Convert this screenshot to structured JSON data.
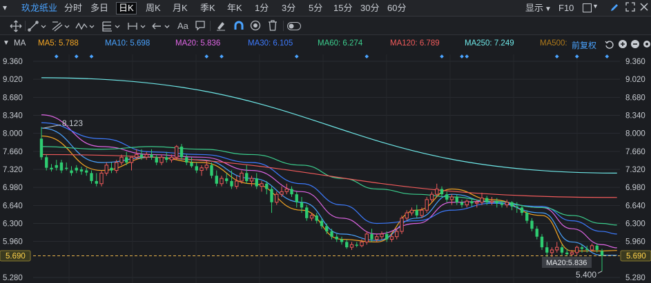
{
  "header": {
    "stock_name": "玖龙纸业",
    "tabs": [
      "分时",
      "多日",
      "日K",
      "周K",
      "月K",
      "季K",
      "年K",
      "1分",
      "3分",
      "5分",
      "15分",
      "30分",
      "60分"
    ],
    "active_tab": "日K",
    "display_label": "显示",
    "f10_label": "F10"
  },
  "toolbar": {
    "icons": [
      "move-cross-icon",
      "line-tool-icon",
      "channel-tool-icon",
      "wave-tool-icon",
      "fib-tool-icon",
      "measure-tool-icon",
      "arrow-tool-icon",
      "text-tool-icon",
      "comment-tool-icon",
      "eraser-icon",
      "magnet-icon",
      "eye-icon",
      "trash-icon",
      "toggle-icon"
    ],
    "text_label": "Aa"
  },
  "indicator": {
    "name": "MA",
    "items": [
      {
        "label": "MA5: 5.788",
        "color": "#f5a623"
      },
      {
        "label": "MA10: 5.698",
        "color": "#4aa3ff"
      },
      {
        "label": "MA20: 5.836",
        "color": "#e066e6"
      },
      {
        "label": "MA30: 6.105",
        "color": "#3d7bff"
      },
      {
        "label": "MA60: 6.274",
        "color": "#3ccf8e"
      },
      {
        "label": "MA120: 6.789",
        "color": "#f25b5b"
      },
      {
        "label": "MA250: 7.249",
        "color": "#6fe8e8"
      },
      {
        "label": "MA500:",
        "color": "#b07a1a"
      }
    ],
    "adjust_label": "前复权"
  },
  "chart_data": {
    "type": "candlestick",
    "y_ticks": [
      "9.360",
      "9.020",
      "8.680",
      "8.340",
      "8.000",
      "7.660",
      "7.320",
      "6.980",
      "6.640",
      "6.300",
      "5.960",
      "5.280"
    ],
    "current_price": "5.690",
    "high_label": "8.123",
    "low_label": "5.400",
    "tooltip": "MA20:5.836",
    "ylim": [
      5.2,
      9.4
    ],
    "colors": {
      "up": "#f25b5b",
      "down": "#2ecc71"
    },
    "candles": [
      [
        7.9,
        8.12,
        7.55,
        7.5
      ],
      [
        7.55,
        7.6,
        7.35,
        7.3
      ],
      [
        7.35,
        7.42,
        7.32,
        7.28
      ],
      [
        7.4,
        7.5,
        7.35,
        7.3
      ],
      [
        7.45,
        7.5,
        7.3,
        7.25
      ],
      [
        7.35,
        7.45,
        7.33,
        7.3
      ],
      [
        7.3,
        7.38,
        7.25,
        7.2
      ],
      [
        7.35,
        7.4,
        7.3,
        7.25
      ],
      [
        7.32,
        7.37,
        7.28,
        7.22
      ],
      [
        7.3,
        7.35,
        7.26,
        7.2
      ],
      [
        7.25,
        7.3,
        7.1,
        7.05
      ],
      [
        7.1,
        7.25,
        7.05,
        7.0
      ],
      [
        7.05,
        7.3,
        7.25,
        7.0
      ],
      [
        7.25,
        7.45,
        7.4,
        7.2
      ],
      [
        7.35,
        7.45,
        7.3,
        7.25
      ],
      [
        7.3,
        7.5,
        7.45,
        7.25
      ],
      [
        7.45,
        7.6,
        7.55,
        7.4
      ],
      [
        7.55,
        7.65,
        7.45,
        7.4
      ],
      [
        7.45,
        7.5,
        7.55,
        7.3
      ],
      [
        7.55,
        7.7,
        7.6,
        7.5
      ],
      [
        7.6,
        7.7,
        7.55,
        7.5
      ],
      [
        7.55,
        7.65,
        7.6,
        7.5
      ],
      [
        7.6,
        7.7,
        7.55,
        7.5
      ],
      [
        7.55,
        7.6,
        7.45,
        7.4
      ],
      [
        7.45,
        7.6,
        7.55,
        7.4
      ],
      [
        7.55,
        7.65,
        7.5,
        7.45
      ],
      [
        7.5,
        7.6,
        7.55,
        7.45
      ],
      [
        7.55,
        7.78,
        7.75,
        7.5
      ],
      [
        7.75,
        7.8,
        7.55,
        7.5
      ],
      [
        7.55,
        7.6,
        7.45,
        7.4
      ],
      [
        7.45,
        7.55,
        7.38,
        7.35
      ],
      [
        7.38,
        7.45,
        7.3,
        7.25
      ],
      [
        7.3,
        7.4,
        7.35,
        7.2
      ],
      [
        7.35,
        7.5,
        7.4,
        7.3
      ],
      [
        7.4,
        7.45,
        7.2,
        7.15
      ],
      [
        7.2,
        7.3,
        7.05,
        7.0
      ],
      [
        7.05,
        7.2,
        7.15,
        7.0
      ],
      [
        7.15,
        7.25,
        7.1,
        7.05
      ],
      [
        7.1,
        7.3,
        7.0,
        6.95
      ],
      [
        7.0,
        7.2,
        7.1,
        6.95
      ],
      [
        7.1,
        7.3,
        7.25,
        7.05
      ],
      [
        7.25,
        7.4,
        7.1,
        7.05
      ],
      [
        7.1,
        7.2,
        7.15,
        7.0
      ],
      [
        7.15,
        7.25,
        7.0,
        6.95
      ],
      [
        7.0,
        7.1,
        7.05,
        6.9
      ],
      [
        7.05,
        7.1,
        6.95,
        6.85
      ],
      [
        6.95,
        7.0,
        6.7,
        6.5
      ],
      [
        6.7,
        6.9,
        6.85,
        6.65
      ],
      [
        6.85,
        7.0,
        6.9,
        6.8
      ],
      [
        6.9,
        7.05,
        6.95,
        6.85
      ],
      [
        6.95,
        7.0,
        6.85,
        6.8
      ],
      [
        6.85,
        6.9,
        6.7,
        6.6
      ],
      [
        6.7,
        6.8,
        6.6,
        6.5
      ],
      [
        6.6,
        6.65,
        6.4,
        6.35
      ],
      [
        6.4,
        6.5,
        6.45,
        6.35
      ],
      [
        6.45,
        6.5,
        6.35,
        6.3
      ],
      [
        6.35,
        6.4,
        6.25,
        6.2
      ],
      [
        6.25,
        6.3,
        6.15,
        6.1
      ],
      [
        6.15,
        6.2,
        6.05,
        6.0
      ],
      [
        6.05,
        6.1,
        6.0,
        5.95
      ],
      [
        6.0,
        6.05,
        5.95,
        5.9
      ],
      [
        5.95,
        6.0,
        5.85,
        5.82
      ],
      [
        5.85,
        5.95,
        5.9,
        5.8
      ],
      [
        5.9,
        5.95,
        5.88,
        5.85
      ],
      [
        5.88,
        6.0,
        5.95,
        5.85
      ],
      [
        5.95,
        6.15,
        6.1,
        5.9
      ],
      [
        6.1,
        6.2,
        6.0,
        5.95
      ],
      [
        6.0,
        6.1,
        6.05,
        5.95
      ],
      [
        6.05,
        6.15,
        6.1,
        6.0
      ],
      [
        6.1,
        6.15,
        6.0,
        5.95
      ],
      [
        6.0,
        6.1,
        6.05,
        5.95
      ],
      [
        6.05,
        6.2,
        6.15,
        6.0
      ],
      [
        6.15,
        6.45,
        6.4,
        6.1
      ],
      [
        6.4,
        6.55,
        6.5,
        6.35
      ],
      [
        6.5,
        6.6,
        6.55,
        6.45
      ],
      [
        6.55,
        6.65,
        6.45,
        6.4
      ],
      [
        6.45,
        6.6,
        6.55,
        6.4
      ],
      [
        6.55,
        6.8,
        6.75,
        6.5
      ],
      [
        6.75,
        6.9,
        6.85,
        6.7
      ],
      [
        6.85,
        7.05,
        6.95,
        6.8
      ],
      [
        6.95,
        7.0,
        6.85,
        6.8
      ],
      [
        6.85,
        6.9,
        6.75,
        6.7
      ],
      [
        6.75,
        6.85,
        6.8,
        6.65
      ],
      [
        6.8,
        6.85,
        6.7,
        6.65
      ],
      [
        6.7,
        6.75,
        6.65,
        6.6
      ],
      [
        6.65,
        6.75,
        6.72,
        6.6
      ],
      [
        6.72,
        6.78,
        6.68,
        6.62
      ],
      [
        6.68,
        6.75,
        6.7,
        6.6
      ],
      [
        6.7,
        6.88,
        6.78,
        6.65
      ],
      [
        6.78,
        6.82,
        6.7,
        6.65
      ],
      [
        6.7,
        6.8,
        6.72,
        6.65
      ],
      [
        6.72,
        6.78,
        6.68,
        6.6
      ],
      [
        6.68,
        6.72,
        6.65,
        6.6
      ],
      [
        6.65,
        6.75,
        6.7,
        6.6
      ],
      [
        6.7,
        6.72,
        6.62,
        6.55
      ],
      [
        6.62,
        6.7,
        6.6,
        6.5
      ],
      [
        6.6,
        6.65,
        6.5,
        6.45
      ],
      [
        6.5,
        6.55,
        6.35,
        6.3
      ],
      [
        6.35,
        6.4,
        6.2,
        6.15
      ],
      [
        6.2,
        6.25,
        6.05,
        6.0
      ],
      [
        6.05,
        6.1,
        5.85,
        5.8
      ],
      [
        5.85,
        5.95,
        5.75,
        5.65
      ],
      [
        5.75,
        5.85,
        5.8,
        5.6
      ],
      [
        5.8,
        5.95,
        5.85,
        5.75
      ],
      [
        5.85,
        5.9,
        5.75,
        5.7
      ],
      [
        5.75,
        5.82,
        5.72,
        5.68
      ],
      [
        5.72,
        5.8,
        5.75,
        5.68
      ],
      [
        5.75,
        5.88,
        5.85,
        5.7
      ],
      [
        5.85,
        5.9,
        5.82,
        5.75
      ],
      [
        5.82,
        5.88,
        5.8,
        5.75
      ],
      [
        5.8,
        5.92,
        5.88,
        5.78
      ],
      [
        5.88,
        5.92,
        5.8,
        5.75
      ],
      [
        5.78,
        5.82,
        5.69,
        5.4
      ]
    ],
    "ma_lines": [
      {
        "name": "MA5",
        "color": "#f5a623",
        "x": [
          0,
          12,
          22,
          32,
          42,
          52,
          60,
          67,
          75,
          82,
          90,
          100,
          106,
          112,
          115
        ],
        "y": [
          7.95,
          7.3,
          7.55,
          7.45,
          7.05,
          6.55,
          6.0,
          5.95,
          6.55,
          6.95,
          6.75,
          6.45,
          5.78,
          5.78,
          5.79
        ]
      },
      {
        "name": "MA10",
        "color": "#4aa3ff",
        "x": [
          0,
          12,
          22,
          32,
          42,
          52,
          60,
          67,
          75,
          82,
          90,
          100,
          106,
          112,
          115
        ],
        "y": [
          8.1,
          7.45,
          7.55,
          7.5,
          7.15,
          6.7,
          6.1,
          5.98,
          6.4,
          6.85,
          6.7,
          6.5,
          5.95,
          5.7,
          5.7
        ]
      },
      {
        "name": "MA20",
        "color": "#e066e6",
        "x": [
          0,
          12,
          22,
          32,
          42,
          52,
          60,
          67,
          75,
          82,
          90,
          100,
          106,
          112,
          115
        ],
        "y": [
          8.35,
          7.75,
          7.6,
          7.55,
          7.3,
          6.9,
          6.4,
          6.1,
          6.3,
          6.7,
          6.72,
          6.6,
          6.2,
          5.9,
          5.84
        ]
      },
      {
        "name": "MA30",
        "color": "#3d7bff",
        "x": [
          0,
          12,
          22,
          32,
          42,
          52,
          60,
          67,
          75,
          82,
          90,
          100,
          106,
          112,
          115
        ],
        "y": [
          8.2,
          7.9,
          7.65,
          7.6,
          7.45,
          7.05,
          6.65,
          6.3,
          6.35,
          6.55,
          6.68,
          6.62,
          6.35,
          6.15,
          6.1
        ]
      },
      {
        "name": "MA60",
        "color": "#3ccf8e",
        "x": [
          0,
          12,
          22,
          32,
          42,
          52,
          60,
          67,
          75,
          82,
          90,
          100,
          106,
          112,
          115
        ],
        "y": [
          7.75,
          7.7,
          7.75,
          7.7,
          7.6,
          7.4,
          7.15,
          6.95,
          6.85,
          6.8,
          6.72,
          6.6,
          6.45,
          6.3,
          6.27
        ]
      },
      {
        "name": "MA120",
        "color": "#f25b5b",
        "x": [
          0,
          115
        ],
        "y": [
          7.6,
          6.79
        ]
      },
      {
        "name": "MA250",
        "color": "#6fe8e8",
        "x": [
          0,
          115
        ],
        "y": [
          9.05,
          7.25
        ]
      }
    ],
    "marker_indices": [
      3,
      7,
      10,
      33,
      36,
      51,
      65,
      80,
      84,
      85,
      103,
      107,
      113
    ]
  }
}
